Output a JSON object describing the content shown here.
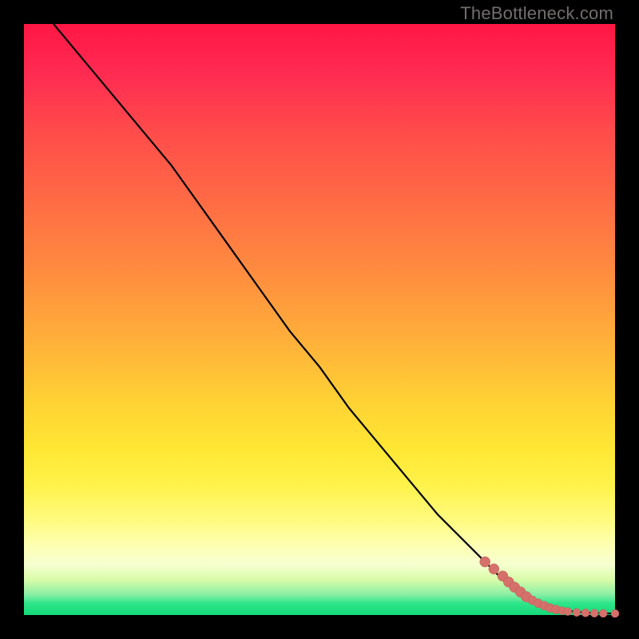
{
  "watermark": "TheBottleneck.com",
  "colors": {
    "marker": "#d6706b",
    "curve": "#000000"
  },
  "chart_data": {
    "type": "line",
    "title": "",
    "xlabel": "",
    "ylabel": "",
    "xlim": [
      0,
      100
    ],
    "ylim": [
      0,
      100
    ],
    "grid": false,
    "legend": false,
    "series": [
      {
        "name": "curve",
        "x": [
          5,
          10,
          15,
          20,
          25,
          30,
          35,
          40,
          45,
          50,
          55,
          60,
          65,
          70,
          75,
          80,
          82,
          84,
          86,
          88,
          90,
          92,
          94,
          96,
          98,
          100
        ],
        "y": [
          100,
          94,
          88,
          82,
          76,
          69,
          62,
          55,
          48,
          42,
          35,
          29,
          23,
          17,
          12,
          7,
          5,
          3.5,
          2.5,
          1.7,
          1.1,
          0.7,
          0.5,
          0.35,
          0.28,
          0.25
        ]
      }
    ],
    "points": {
      "name": "highlighted-range",
      "x": [
        78,
        79.5,
        81,
        82,
        83,
        84,
        85,
        86,
        87,
        88,
        89,
        90,
        91,
        92,
        93.5,
        95,
        96.5,
        98,
        100
      ],
      "y": [
        9,
        7.8,
        6.6,
        5.6,
        4.7,
        3.9,
        3.1,
        2.5,
        2.0,
        1.6,
        1.2,
        0.95,
        0.75,
        0.6,
        0.45,
        0.36,
        0.31,
        0.28,
        0.26
      ]
    }
  }
}
